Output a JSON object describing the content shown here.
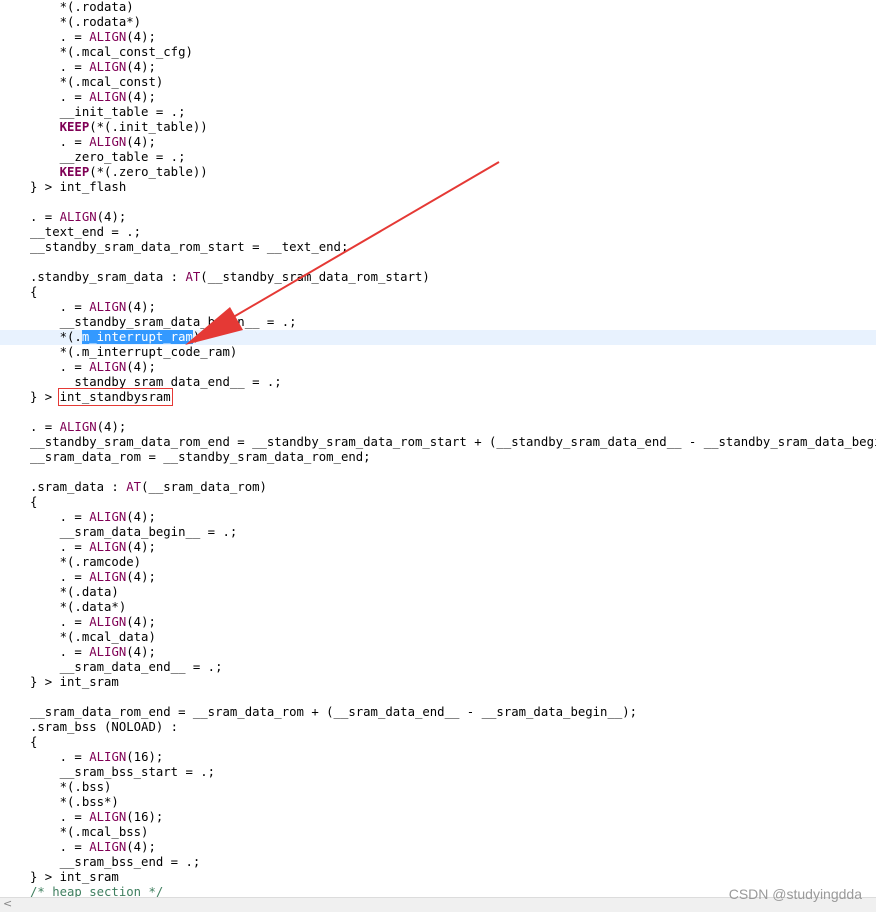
{
  "code_lines": [
    [
      {
        "t": "    *(.rodata)"
      }
    ],
    [
      {
        "t": "    *(.rodata*)"
      }
    ],
    [
      {
        "t": "    . = "
      },
      {
        "t": "ALIGN",
        "c": "fn"
      },
      {
        "t": "(4);"
      }
    ],
    [
      {
        "t": "    *(.mcal_const_cfg)"
      }
    ],
    [
      {
        "t": "    . = "
      },
      {
        "t": "ALIGN",
        "c": "fn"
      },
      {
        "t": "(4);"
      }
    ],
    [
      {
        "t": "    *(.mcal_const)"
      }
    ],
    [
      {
        "t": "    . = "
      },
      {
        "t": "ALIGN",
        "c": "fn"
      },
      {
        "t": "(4);"
      }
    ],
    [
      {
        "t": "    __init_table = .;"
      }
    ],
    [
      {
        "t": "    "
      },
      {
        "t": "KEEP",
        "c": "kw"
      },
      {
        "t": "(*(.init_table))"
      }
    ],
    [
      {
        "t": "    . = "
      },
      {
        "t": "ALIGN",
        "c": "fn"
      },
      {
        "t": "(4);"
      }
    ],
    [
      {
        "t": "    __zero_table = .;"
      }
    ],
    [
      {
        "t": "    "
      },
      {
        "t": "KEEP",
        "c": "kw"
      },
      {
        "t": "(*(.zero_table))"
      }
    ],
    [
      {
        "t": "} > int_flash"
      }
    ],
    [],
    [
      {
        "t": ". = "
      },
      {
        "t": "ALIGN",
        "c": "fn"
      },
      {
        "t": "(4);"
      }
    ],
    [
      {
        "t": "__text_end = .;"
      }
    ],
    [
      {
        "t": "__standby_sram_data_rom_start = __text_end;"
      }
    ],
    [],
    [
      {
        "t": ".standby_sram_data : "
      },
      {
        "t": "AT",
        "c": "fn"
      },
      {
        "t": "(__standby_sram_data_rom_start)"
      }
    ],
    [
      {
        "t": "{"
      }
    ],
    [
      {
        "t": "    . = "
      },
      {
        "t": "ALIGN",
        "c": "fn"
      },
      {
        "t": "(4);"
      }
    ],
    [
      {
        "t": "    __standby_sram_data_begin__ = .;"
      }
    ],
    [
      {
        "t": "    *(."
      },
      {
        "t": "m_interrupt_ram",
        "c": "sel"
      },
      {
        "t": ")"
      }
    ],
    [
      {
        "t": "    *(.m_interrupt_code_ram)"
      }
    ],
    [
      {
        "t": "    . = "
      },
      {
        "t": "ALIGN",
        "c": "fn"
      },
      {
        "t": "(4);"
      }
    ],
    [
      {
        "t": "    __standby_sram_data_end__ = .;"
      }
    ],
    [
      {
        "t": "} > "
      },
      {
        "t": "int_standbysram",
        "c": "boxed"
      }
    ],
    [],
    [
      {
        "t": ". = "
      },
      {
        "t": "ALIGN",
        "c": "fn"
      },
      {
        "t": "(4);"
      }
    ],
    [
      {
        "t": "__standby_sram_data_rom_end = __standby_sram_data_rom_start + (__standby_sram_data_end__ - __standby_sram_data_begin__);"
      }
    ],
    [
      {
        "t": "__sram_data_rom = __standby_sram_data_rom_end;"
      }
    ],
    [],
    [
      {
        "t": ".sram_data : "
      },
      {
        "t": "AT",
        "c": "fn"
      },
      {
        "t": "(__sram_data_rom)"
      }
    ],
    [
      {
        "t": "{"
      }
    ],
    [
      {
        "t": "    . = "
      },
      {
        "t": "ALIGN",
        "c": "fn"
      },
      {
        "t": "(4);"
      }
    ],
    [
      {
        "t": "    __sram_data_begin__ = .;"
      }
    ],
    [
      {
        "t": "    . = "
      },
      {
        "t": "ALIGN",
        "c": "fn"
      },
      {
        "t": "(4);"
      }
    ],
    [
      {
        "t": "    *(.ramcode)"
      }
    ],
    [
      {
        "t": "    . = "
      },
      {
        "t": "ALIGN",
        "c": "fn"
      },
      {
        "t": "(4);"
      }
    ],
    [
      {
        "t": "    *(.data)"
      }
    ],
    [
      {
        "t": "    *(.data*)"
      }
    ],
    [
      {
        "t": "    . = "
      },
      {
        "t": "ALIGN",
        "c": "fn"
      },
      {
        "t": "(4);"
      }
    ],
    [
      {
        "t": "    *(.mcal_data)"
      }
    ],
    [
      {
        "t": "    . = "
      },
      {
        "t": "ALIGN",
        "c": "fn"
      },
      {
        "t": "(4);"
      }
    ],
    [
      {
        "t": "    __sram_data_end__ = .;"
      }
    ],
    [
      {
        "t": "} > int_sram"
      }
    ],
    [],
    [
      {
        "t": "__sram_data_rom_end = __sram_data_rom + (__sram_data_end__ - __sram_data_begin__);"
      }
    ],
    [
      {
        "t": ".sram_bss (NOLOAD) :"
      }
    ],
    [
      {
        "t": "{"
      }
    ],
    [
      {
        "t": "    . = "
      },
      {
        "t": "ALIGN",
        "c": "fn"
      },
      {
        "t": "(16);"
      }
    ],
    [
      {
        "t": "    __sram_bss_start = .;"
      }
    ],
    [
      {
        "t": "    *(.bss)"
      }
    ],
    [
      {
        "t": "    *(.bss*)"
      }
    ],
    [
      {
        "t": "    . = "
      },
      {
        "t": "ALIGN",
        "c": "fn"
      },
      {
        "t": "(16);"
      }
    ],
    [
      {
        "t": "    *(.mcal_bss)"
      }
    ],
    [
      {
        "t": "    . = "
      },
      {
        "t": "ALIGN",
        "c": "fn"
      },
      {
        "t": "(4);"
      }
    ],
    [
      {
        "t": "    __sram_bss_end = .;"
      }
    ],
    [
      {
        "t": "} > int_sram"
      }
    ],
    [
      {
        "t": "/* heap section */",
        "c": "comment"
      }
    ]
  ],
  "current_line_index": 22,
  "scrollbar": {
    "left_arrow": "<"
  },
  "watermark": "CSDN @studyingdda",
  "colors": {
    "keyword": "#7f0055",
    "comment": "#3f7f5f",
    "selection": "#3399ff",
    "current_line": "#e8f2fe",
    "annotation_red": "#e53935"
  }
}
